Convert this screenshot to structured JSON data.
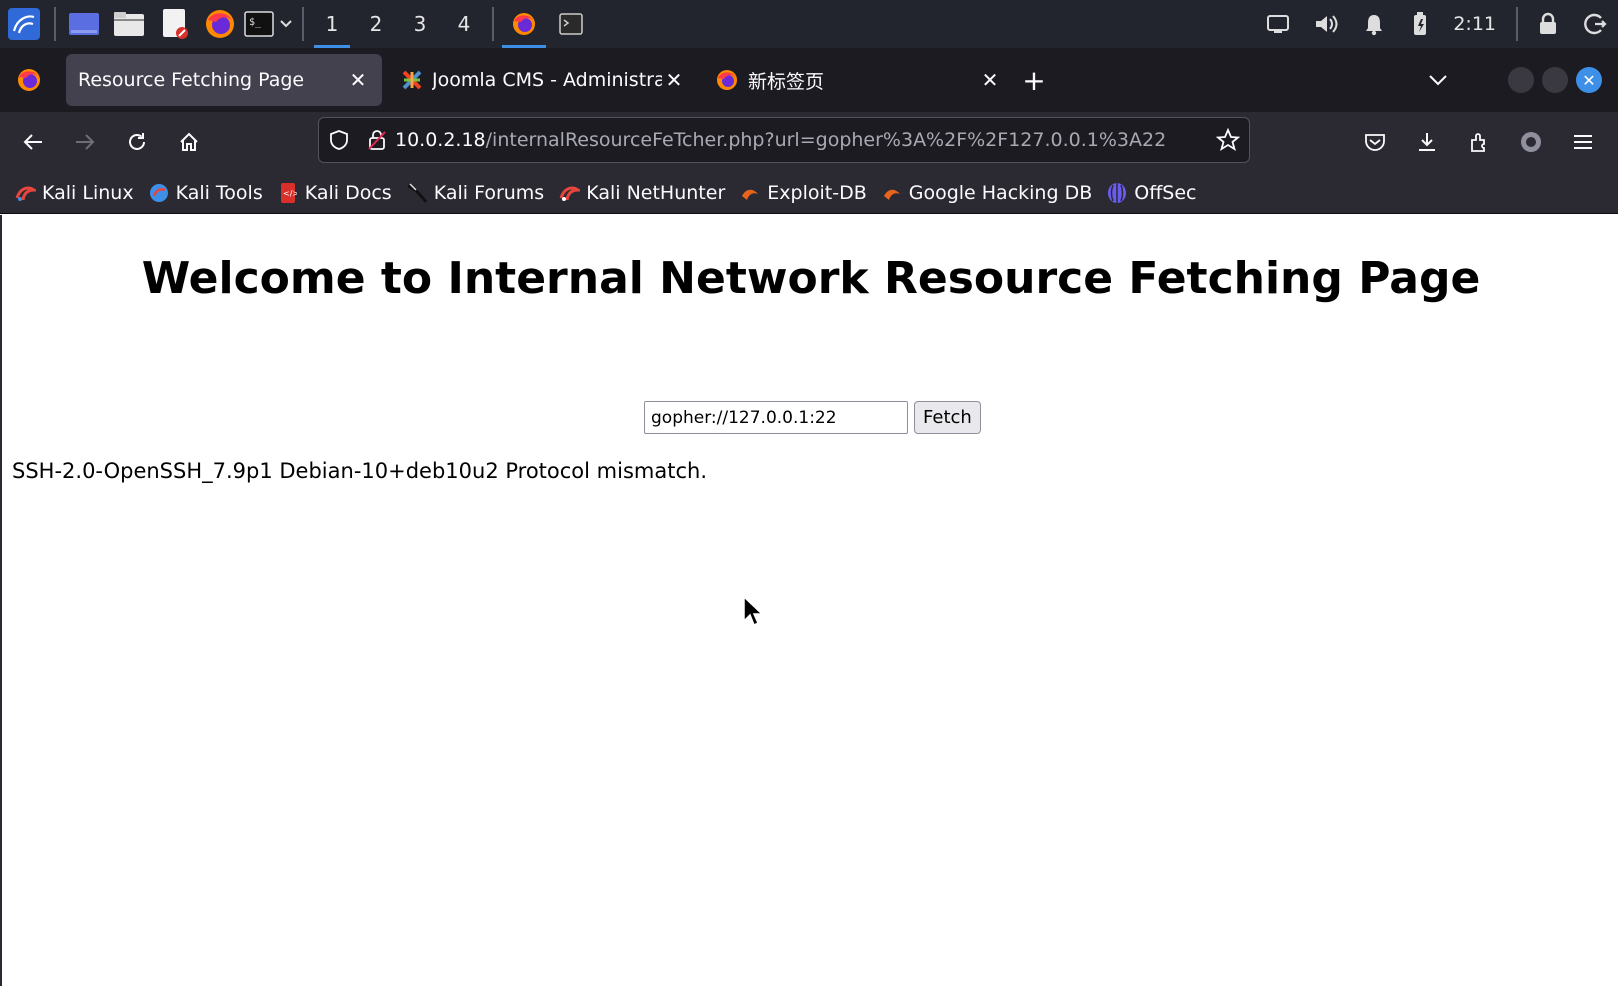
{
  "taskbar": {
    "workspaces": [
      "1",
      "2",
      "3",
      "4"
    ],
    "active_workspace": "1",
    "clock": "2:11"
  },
  "tabs": [
    {
      "label": "Resource Fetching Page",
      "active": true,
      "icon": "firefox-icon"
    },
    {
      "label": "Joomla CMS - Administrat",
      "active": false,
      "icon": "joomla-icon"
    },
    {
      "label": "新标签页",
      "active": false,
      "icon": "firefox-icon"
    }
  ],
  "urlbar": {
    "host": "10.0.2.18",
    "path": "/internalResourceFeTcher.php?url=gopher%3A%2F%2F127.0.0.1%3A22"
  },
  "bookmarks": [
    {
      "label": "Kali Linux",
      "icon": "kali-dragon-icon",
      "color": "#e8453c"
    },
    {
      "label": "Kali Tools",
      "icon": "kali-tools-icon",
      "color": "#3d8fe8"
    },
    {
      "label": "Kali Docs",
      "icon": "kali-docs-icon",
      "color": "#d9302c"
    },
    {
      "label": "Kali Forums",
      "icon": "kali-forums-icon",
      "color": "#111111"
    },
    {
      "label": "Kali NetHunter",
      "icon": "kali-nethunter-icon",
      "color": "#e8453c"
    },
    {
      "label": "Exploit-DB",
      "icon": "exploit-db-icon",
      "color": "#e8641c"
    },
    {
      "label": "Google Hacking DB",
      "icon": "ghdb-icon",
      "color": "#e8641c"
    },
    {
      "label": "OffSec",
      "icon": "offsec-icon",
      "color": "#6b5cf0"
    }
  ],
  "page": {
    "title": "Welcome to Internal Network Resource Fetching Page",
    "input_value": "gopher://127.0.0.1:22",
    "button_label": "Fetch",
    "result": "SSH-2.0-OpenSSH_7.9p1 Debian-10+deb10u2 Protocol mismatch."
  },
  "colors": {
    "accent": "#3d8fe8",
    "toolbar_bg": "#2b2a33",
    "tabstrip_bg": "#1c1b22",
    "taskbar_bg": "#23252e"
  }
}
